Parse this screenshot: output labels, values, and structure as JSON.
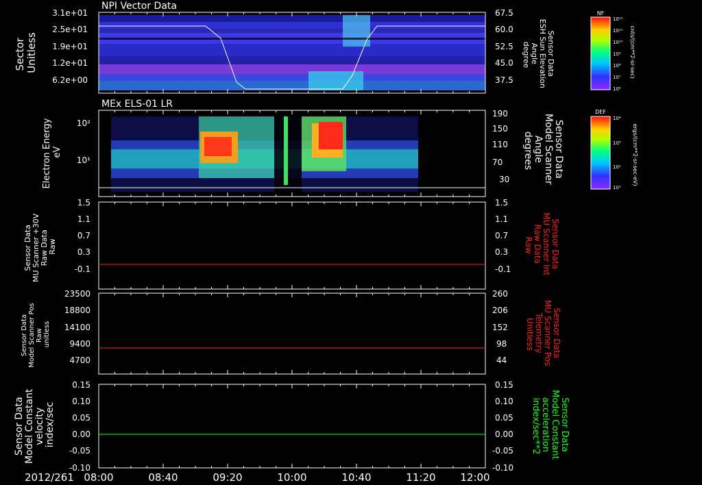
{
  "timestamp_label": "2012/261",
  "time_ticks": [
    "08:00",
    "08:40",
    "09:20",
    "10:00",
    "10:40",
    "11:20",
    "12:00"
  ],
  "colors": {
    "red": "#ff2020",
    "green": "#20ff20",
    "white": "#ffffff"
  },
  "panels": [
    {
      "title": "NPI Vector Data",
      "left_label": [
        "Sector",
        "Unitless"
      ],
      "left_ticks": [
        "3.1e+01",
        "2.5e+01",
        "1.9e+01",
        "1.2e+01",
        "6.2e+00"
      ],
      "right_label": [
        "Sensor Data",
        "ESH Sun Elevation",
        "Angle",
        "degree"
      ],
      "right_ticks": [
        "67.5",
        "60.0",
        "52.5",
        "45.0",
        "37.5"
      ],
      "colorbar_title": "NF",
      "colorbar_ticks": [
        "10¹²",
        "10¹¹",
        "10¹⁰",
        "10⁹",
        "10⁸",
        "10⁷",
        "10⁶"
      ],
      "colorbar_unit": "cnts/(cm**2-sr-sec)"
    },
    {
      "title": "MEx ELS-01 LR",
      "left_label": [
        "Electron Energy",
        "eV"
      ],
      "left_ticks": [
        "10²",
        "10¹"
      ],
      "right_label": [
        "Sensor Data",
        "Model Scanner",
        "Angle",
        "degrees"
      ],
      "right_ticks": [
        "190",
        "150",
        "110",
        "70",
        "30"
      ],
      "colorbar_title": "DEF",
      "colorbar_ticks": [
        "10⁴",
        "10³",
        "10²",
        "10¹"
      ],
      "colorbar_unit": "ergs/(cm**2-sr-sec-eV)"
    },
    {
      "left_label": [
        "Sensor Data",
        "MU Scanner +30V",
        "Raw Data",
        "Raw"
      ],
      "left_ticks": [
        "1.5",
        "1.1",
        "0.7",
        "0.3",
        "-0.1"
      ],
      "right_label": [
        "Sensor Data",
        "MU Scanner Int",
        "Raw Data",
        "Raw"
      ],
      "right_ticks": [
        "1.5",
        "1.1",
        "0.7",
        "0.3",
        "-0.1"
      ]
    },
    {
      "left_label": [
        "Sensor Data",
        "Model Scanner Pos",
        "Raw",
        "unitless"
      ],
      "left_ticks": [
        "23500",
        "18800",
        "14100",
        "9400",
        "4700"
      ],
      "right_label": [
        "Sensor Data",
        "MU Scanner Pos",
        "Telemetry",
        "Unitless"
      ],
      "right_ticks": [
        "260",
        "206",
        "152",
        "98",
        "44"
      ]
    },
    {
      "left_label": [
        "Sensor Data",
        "Model Constant",
        "velocity",
        "index/sec"
      ],
      "left_ticks": [
        "0.15",
        "0.10",
        "0.05",
        "0.00",
        "-0.05",
        "-0.10"
      ],
      "right_label": [
        "Sensor Data",
        "Model Constant",
        "acceleration",
        "index/sec**2"
      ],
      "right_ticks": [
        "0.15",
        "0.10",
        "0.05",
        "0.00",
        "-0.05",
        "-0.10"
      ]
    }
  ],
  "chart_data": [
    {
      "type": "heatmap",
      "title": "NPI Vector Data",
      "xlabel": "",
      "ylabel": "Sector Unitless",
      "x_range": [
        "08:00",
        "12:00"
      ],
      "y_range": [
        0,
        31
      ],
      "line_overlay": {
        "name": "ESH Sun Elevation Angle",
        "x": [
          "08:00",
          "09:00",
          "09:20",
          "10:00",
          "10:20",
          "10:40",
          "12:00"
        ],
        "values": [
          60.0,
          60.0,
          37.0,
          37.0,
          37.0,
          60.0,
          60.0
        ]
      }
    },
    {
      "type": "heatmap",
      "title": "MEx ELS-01 LR",
      "ylabel": "Electron Energy eV",
      "x_range": [
        "08:00",
        "12:00"
      ],
      "y_range_log": [
        1,
        200
      ],
      "line_overlay": {
        "name": "Model Scanner Angle",
        "values": [
          20,
          20
        ]
      }
    },
    {
      "type": "line",
      "x": [
        "08:00",
        "12:00"
      ],
      "series": [
        {
          "name": "MU Scanner +30V Raw Data",
          "values": [
            0.0,
            0.0
          ]
        }
      ],
      "ylim": [
        -0.3,
        1.5
      ]
    },
    {
      "type": "line",
      "x": [
        "08:00",
        "12:00"
      ],
      "series": [
        {
          "name": "Model Scanner Pos Raw",
          "values": [
            8000,
            8000
          ]
        }
      ],
      "ylim": [
        0,
        23500
      ]
    },
    {
      "type": "line",
      "x": [
        "08:00",
        "12:00"
      ],
      "series": [
        {
          "name": "Model Constant velocity",
          "values": [
            0.0,
            0.0
          ]
        }
      ],
      "ylim": [
        -0.1,
        0.15
      ]
    }
  ]
}
